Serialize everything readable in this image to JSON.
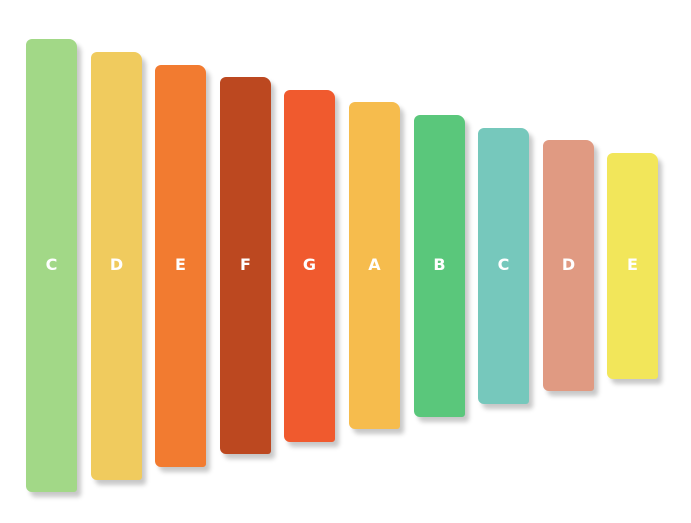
{
  "xylophone": {
    "bars": [
      {
        "note": "C",
        "color": "#a2d887"
      },
      {
        "note": "D",
        "color": "#f0cb5e"
      },
      {
        "note": "E",
        "color": "#f27b30"
      },
      {
        "note": "F",
        "color": "#bc4820"
      },
      {
        "note": "G",
        "color": "#f05a2e"
      },
      {
        "note": "A",
        "color": "#f6bc4d"
      },
      {
        "note": "B",
        "color": "#5ac77b"
      },
      {
        "note": "C",
        "color": "#76c8bc"
      },
      {
        "note": "D",
        "color": "#e09a82"
      },
      {
        "note": "E",
        "color": "#f2e65a"
      }
    ]
  }
}
